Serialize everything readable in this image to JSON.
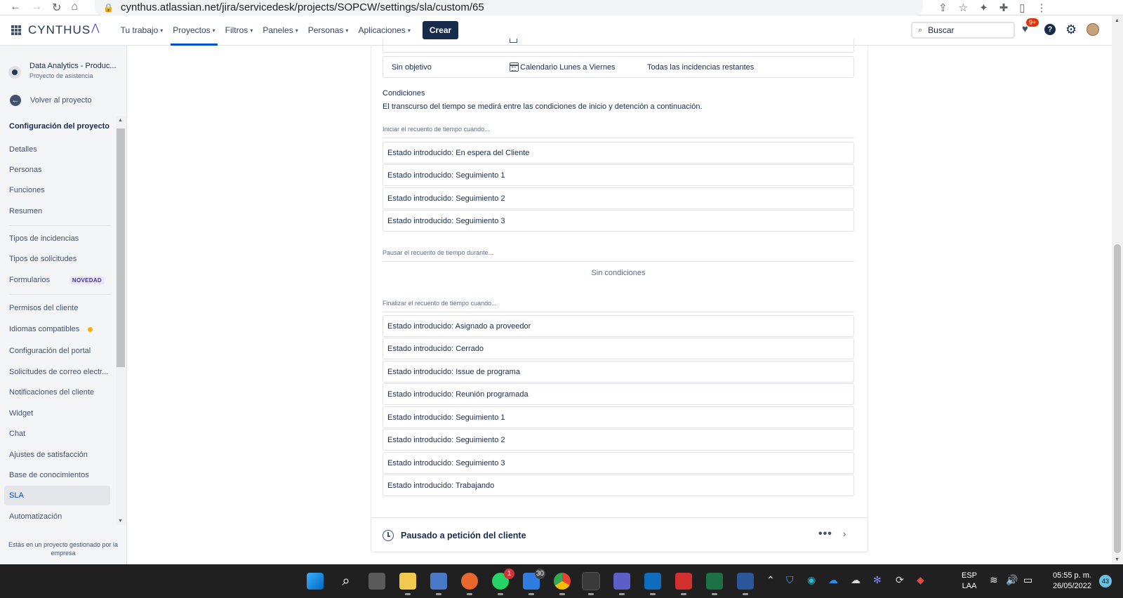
{
  "browser": {
    "url": "cynthus.atlassian.net/jira/servicedesk/projects/SOPCW/settings/sla/custom/65"
  },
  "topbar": {
    "logo": "CYNTHUS",
    "menu": [
      {
        "label": "Tu trabajo"
      },
      {
        "label": "Proyectos"
      },
      {
        "label": "Filtros"
      },
      {
        "label": "Paneles"
      },
      {
        "label": "Personas"
      },
      {
        "label": "Aplicaciones"
      }
    ],
    "create_label": "Crear",
    "search_placeholder": "Buscar",
    "notification_count": "9+"
  },
  "sidebar": {
    "project_name": "Data Analytics - Produc...",
    "project_type": "Proyecto de asistencia",
    "back_label": "Volver al proyecto",
    "section_title": "Configuración del proyecto",
    "items": [
      {
        "label": "Detalles"
      },
      {
        "label": "Personas"
      },
      {
        "label": "Funciones"
      },
      {
        "label": "Resumen"
      },
      {
        "label": "Tipos de incidencias"
      },
      {
        "label": "Tipos de solicitudes"
      },
      {
        "label": "Formularios",
        "tag": "NOVEDAD"
      },
      {
        "label": "Permisos del cliente"
      },
      {
        "label": "Idiomas compatibles"
      },
      {
        "label": "Configuración del portal"
      },
      {
        "label": "Solicitudes de correo electr..."
      },
      {
        "label": "Notificaciones del cliente"
      },
      {
        "label": "Widget"
      },
      {
        "label": "Chat"
      },
      {
        "label": "Ajustes de satisfacción"
      },
      {
        "label": "Base de conocimientos"
      },
      {
        "label": "SLA"
      },
      {
        "label": "Automatización"
      }
    ],
    "footer_note": "Estás en un proyecto gestionado por la empresa"
  },
  "goal_row": {
    "target": "Sin objetivo",
    "calendar": "Calendario Lunes a Viernes",
    "issues": "Todas las incidencias restantes"
  },
  "conditions": {
    "title": "Condiciones",
    "description": "El transcurso del tiempo se medirá entre las condiciones de inicio y detención a continuación.",
    "start_heading": "Iniciar el recuento de tiempo cuando...",
    "start_items": [
      "Estado introducido: En espera del Cliente",
      "Estado introducido: Seguimiento 1",
      "Estado introducido: Seguimiento 2",
      "Estado introducido: Seguimiento 3"
    ],
    "pause_heading": "Pausar el recuento de tiempo durante...",
    "pause_empty": "Sin condiciones",
    "stop_heading": "Finalizar el recuento de tiempo cuando...",
    "stop_items": [
      "Estado introducido: Asignado a proveedor",
      "Estado introducido: Cerrado",
      "Estado introducido: Issue de programa",
      "Estado introducido: Reunión programada",
      "Estado introducido: Seguimiento 1",
      "Estado introducido: Seguimiento 2",
      "Estado introducido: Seguimiento 3",
      "Estado introducido: Trabajando"
    ]
  },
  "next_sla": {
    "title": "Pausado a petición del cliente",
    "more": "•••"
  },
  "taskbar": {
    "whatsapp_badge": "1",
    "todo_badge": "30",
    "lang_line1": "ESP",
    "lang_line2": "LAA",
    "time": "05:55 p. m.",
    "date": "26/05/2022",
    "notifications": "43"
  }
}
